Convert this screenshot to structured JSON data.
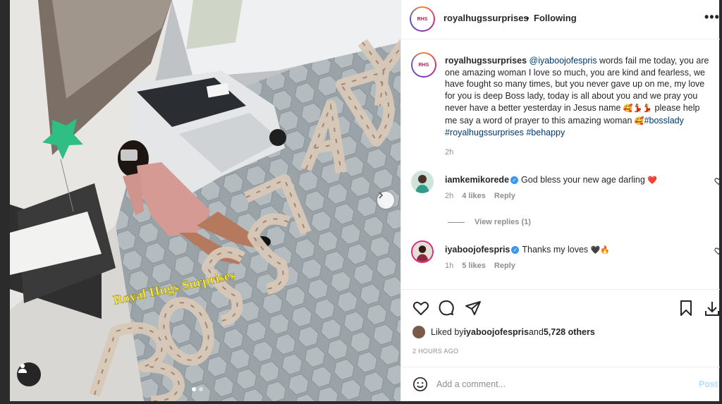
{
  "post": {
    "username": "royalhugssurprises",
    "follow_separator": "•",
    "follow_status": "Following",
    "avatar_text": "RHS",
    "more_icon": "•••"
  },
  "media": {
    "watermark": "Royal Hugs Surprises",
    "next_icon": "chevron-right-icon",
    "tag_icon": "user-tag-icon"
  },
  "caption": {
    "username": "royalhugssurprises",
    "mention": "@iyaboojofespris",
    "text1": " words fail me today, you are one amazing woman I love so much, you are kind and fearless, we have fought so many times, but you never gave up on me, my love for you is deep Boss lady, today is all about you and we pray you never have a better yesterday in Jesus name ",
    "emoji1": "🥰💃💃",
    "text2": " please help me say a word of prayer to this amazing woman ",
    "emoji2": "🥰",
    "tag1": "#bosslady",
    "tag2": "#royalhugssurprises",
    "tag3": "#behappy",
    "time": "2h"
  },
  "comments": [
    {
      "username": "iamkemikorede",
      "verified": "✓",
      "text": "God bless your new age darling",
      "emoji": "❤️",
      "time": "2h",
      "likes": "4 likes",
      "reply": "Reply"
    },
    {
      "username": "iyaboojofespris",
      "verified": "✓",
      "text": "Thanks my loves",
      "emoji": "🖤🔥",
      "time": "1h",
      "likes": "5 likes",
      "reply": "Reply"
    }
  ],
  "view_replies": "View replies (1)",
  "likes": {
    "prefix": "Liked by ",
    "user": "iyaboojofespris",
    "and": " and ",
    "others": "5,728 others"
  },
  "post_time": "2 HOURS AGO",
  "add_comment": {
    "placeholder": "Add a comment...",
    "post_label": "Post"
  },
  "colors": {
    "link": "#00376b",
    "verified": "#3897f0",
    "muted": "#8e8e8e",
    "post_disabled": "#b2dffc"
  }
}
